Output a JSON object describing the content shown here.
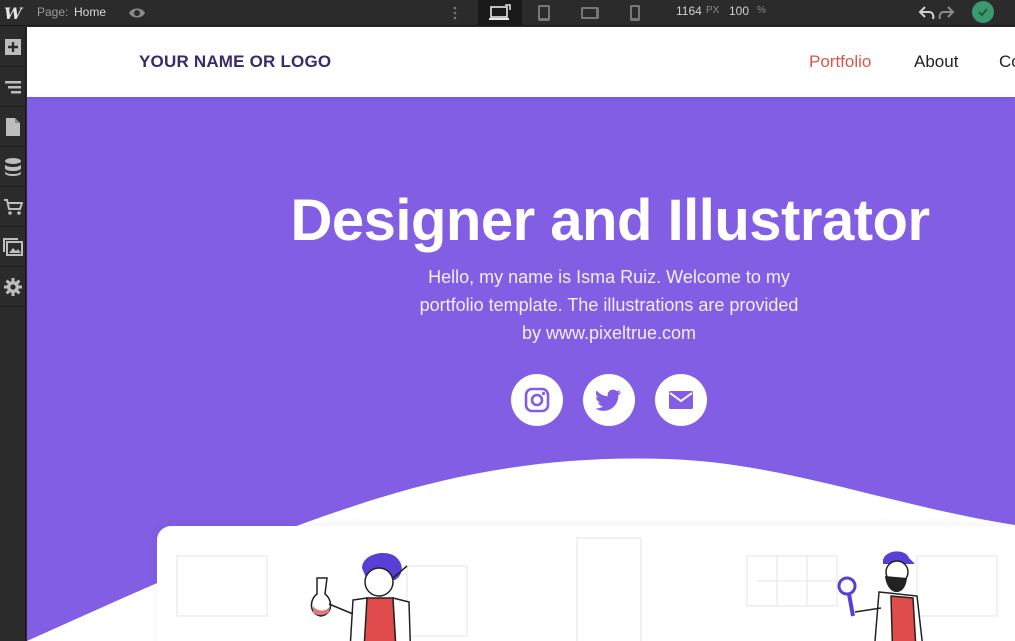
{
  "editor": {
    "app_logo": "W",
    "page_label": "Page:",
    "page_name": "Home",
    "canvas_width": "1164",
    "width_unit": "PX",
    "zoom": "100",
    "zoom_unit": "%",
    "status_color": "#3a9a6e"
  },
  "left_tools": [
    "add-icon",
    "navigator-icon",
    "pages-icon",
    "cms-icon",
    "ecommerce-icon",
    "assets-icon",
    "settings-icon"
  ],
  "site": {
    "brand": "YOUR NAME OR LOGO",
    "nav": [
      {
        "label": "Portfolio"
      },
      {
        "label": "About"
      },
      {
        "label": "Co"
      }
    ],
    "hero": {
      "title": "Designer and Illustrator",
      "line1": "Hello, my name is Isma Ruiz. Welcome to my",
      "line2": "portfolio template. The illustrations are provided",
      "line3": "by www.pixeltrue.com"
    },
    "social": [
      "instagram-icon",
      "twitter-icon",
      "mail-icon"
    ],
    "colors": {
      "hero_bg": "#825ee4",
      "active_link": "#d9574a",
      "brand": "#3a2a6b"
    }
  }
}
